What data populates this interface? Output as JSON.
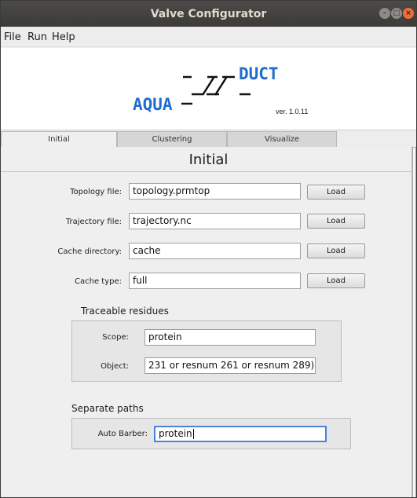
{
  "window": {
    "title": "Valve Configurator"
  },
  "menu": {
    "file": "File",
    "run": "Run",
    "help": "Help"
  },
  "logo": {
    "word1": "AQUA",
    "word2": "DUCT",
    "version": "ver. 1.0.11"
  },
  "tabs": [
    {
      "label": "Initial",
      "active": true
    },
    {
      "label": "Clustering",
      "active": false
    },
    {
      "label": "Visualize",
      "active": false
    }
  ],
  "page": {
    "title": "Initial"
  },
  "fields": {
    "topology": {
      "label": "Topology file:",
      "value": "topology.prmtop",
      "button": "Load"
    },
    "trajectory": {
      "label": "Trajectory file:",
      "value": "trajectory.nc",
      "button": "Load"
    },
    "cache_dir": {
      "label": "Cache directory:",
      "value": "cache",
      "button": "Load"
    },
    "cache_type": {
      "label": "Cache type:",
      "value": "full",
      "button": "Load"
    }
  },
  "traceable": {
    "title": "Traceable residues",
    "scope": {
      "label": "Scope:",
      "value": "protein"
    },
    "object": {
      "label": "Object:",
      "value": "231 or resnum 261 or resnum 289))"
    }
  },
  "separate": {
    "title": "Separate paths",
    "auto_barber": {
      "label": "Auto Barber:",
      "value": "protein"
    }
  },
  "colors": {
    "titlebar": "#3c3b37",
    "close": "#ef6b3c",
    "accent": "#4a84d8",
    "logo": "#1f6ccf"
  }
}
